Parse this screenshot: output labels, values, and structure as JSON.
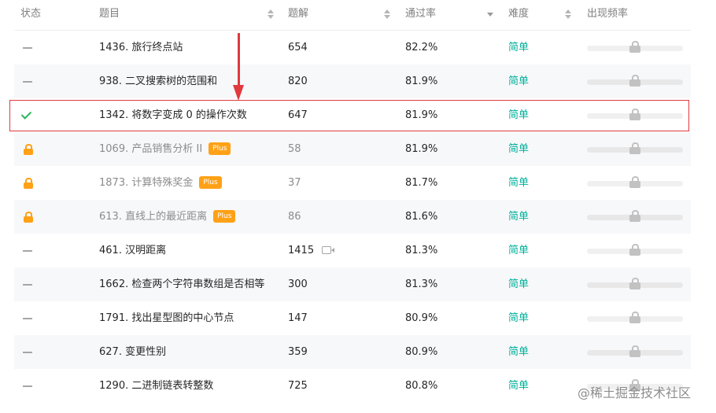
{
  "header": {
    "status": "状态",
    "title": "题目",
    "solutions": "题解",
    "acceptance": "通过率",
    "difficulty": "难度",
    "frequency": "出现频率"
  },
  "rows": [
    {
      "status": "none",
      "title": "1436. 旅行终点站",
      "solutions": "654",
      "acceptance": "82.2%",
      "difficulty": "简单",
      "plus": "",
      "locked": false
    },
    {
      "status": "none",
      "title": "938. 二叉搜索树的范围和",
      "solutions": "820",
      "acceptance": "81.9%",
      "difficulty": "简单",
      "plus": "",
      "locked": false
    },
    {
      "status": "solved",
      "title": "1342. 将数字变成 0 的操作次数",
      "solutions": "647",
      "acceptance": "81.9%",
      "difficulty": "简单",
      "plus": "",
      "locked": false
    },
    {
      "status": "locked",
      "title": "1069. 产品销售分析 II",
      "solutions": "58",
      "acceptance": "81.9%",
      "difficulty": "简单",
      "plus": "Plus",
      "locked": true
    },
    {
      "status": "locked",
      "title": "1873. 计算特殊奖金",
      "solutions": "37",
      "acceptance": "81.7%",
      "difficulty": "简单",
      "plus": "Plus",
      "locked": true
    },
    {
      "status": "locked",
      "title": "613. 直线上的最近距离",
      "solutions": "86",
      "acceptance": "81.6%",
      "difficulty": "简单",
      "plus": "Plus",
      "locked": true
    },
    {
      "status": "none",
      "title": "461. 汉明距离",
      "solutions": "1415",
      "acceptance": "81.3%",
      "difficulty": "简单",
      "plus": "",
      "locked": false,
      "video": true
    },
    {
      "status": "none",
      "title": "1662. 检查两个字符串数组是否相等",
      "solutions": "300",
      "acceptance": "81.3%",
      "difficulty": "简单",
      "plus": "",
      "locked": false
    },
    {
      "status": "none",
      "title": "1791. 找出星型图的中心节点",
      "solutions": "147",
      "acceptance": "80.9%",
      "difficulty": "简单",
      "plus": "",
      "locked": false
    },
    {
      "status": "none",
      "title": "627. 变更性别",
      "solutions": "359",
      "acceptance": "80.9%",
      "difficulty": "简单",
      "plus": "",
      "locked": false
    },
    {
      "status": "none",
      "title": "1290. 二进制链表转整数",
      "solutions": "725",
      "acceptance": "80.8%",
      "difficulty": "简单",
      "plus": "",
      "locked": false
    }
  ],
  "watermark": "@稀土掘金技术社区",
  "colors": {
    "easy": "#00af9b",
    "plus_badge": "#ffa116",
    "solved_check": "#2db55d",
    "annotation": "#e0393e"
  },
  "icons": {
    "status_none": "dash-icon",
    "status_solved": "check-icon",
    "status_locked": "lock-icon",
    "frequency": "lock-icon",
    "video": "video-icon",
    "sort": "sort-icon"
  }
}
